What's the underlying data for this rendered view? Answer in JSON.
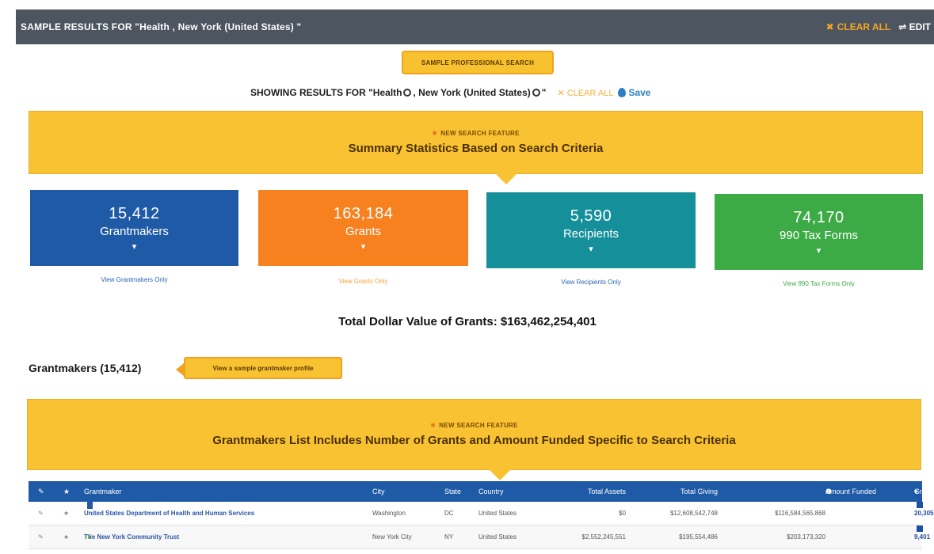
{
  "topbar": {
    "title": "SAMPLE RESULTS FOR \"Health , New York (United States) \"",
    "clear_label": "CLEAR ALL",
    "edit_label": "EDIT"
  },
  "sample_search_label": "SAMPLE PROFESSIONAL SEARCH",
  "showing": {
    "prefix": "SHOWING RESULTS FOR \"Health",
    "middle": ", New York (United States)",
    "suffix": "\"",
    "clear_label": "CLEAR ALL",
    "save_label": "Save"
  },
  "banner_summary": {
    "tag": "NEW SEARCH FEATURE",
    "headline": "Summary Statistics Based on Search Criteria"
  },
  "stats": [
    {
      "number": "15,412",
      "label": "Grantmakers",
      "link": "View Grantmakers Only",
      "color": "#1f5aa6"
    },
    {
      "number": "163,184",
      "label": "Grants",
      "link": "View Grants Only",
      "color": "#f7811f"
    },
    {
      "number": "5,590",
      "label": "Recipients",
      "link": "View Recipients Only",
      "color": "#15909a"
    },
    {
      "number": "74,170",
      "label": "990 Tax Forms",
      "link": "View 990 Tax Forms Only",
      "color": "#3dab45"
    }
  ],
  "total_value": "Total Dollar Value of Grants: $163,462,254,401",
  "grantmakers": {
    "heading": "Grantmakers (15,412)",
    "sample_profile_label": "View a sample grantmaker profile"
  },
  "banner_list": {
    "tag": "NEW SEARCH FEATURE",
    "headline": "Grantmakers List Includes Number of Grants and Amount Funded Specific to Search Criteria"
  },
  "table": {
    "headers": {
      "grantmaker": "Grantmaker",
      "city": "City",
      "state": "State",
      "country": "Country",
      "total_assets": "Total Assets",
      "total_giving": "Total Giving",
      "amount_funded": "Amount Funded",
      "grant_count": "Grant Count"
    },
    "rows": [
      {
        "name": "United States Department of Health and Human Services",
        "city": "Washington",
        "state": "DC",
        "country": "United States",
        "total_assets": "$0",
        "total_giving": "$12,608,542,748",
        "amount_funded": "$116,584,565,868",
        "grant_count": "20,305"
      },
      {
        "name": "The New York Community Trust",
        "city": "New York City",
        "state": "NY",
        "country": "United States",
        "total_assets": "$2,552,245,551",
        "total_giving": "$195,554,486",
        "amount_funded": "$203,173,320",
        "grant_count": "9,401"
      }
    ]
  },
  "colors": {
    "topbar": "#4c5560",
    "banner": "#f9c233",
    "table_header": "#1f5aa6"
  }
}
